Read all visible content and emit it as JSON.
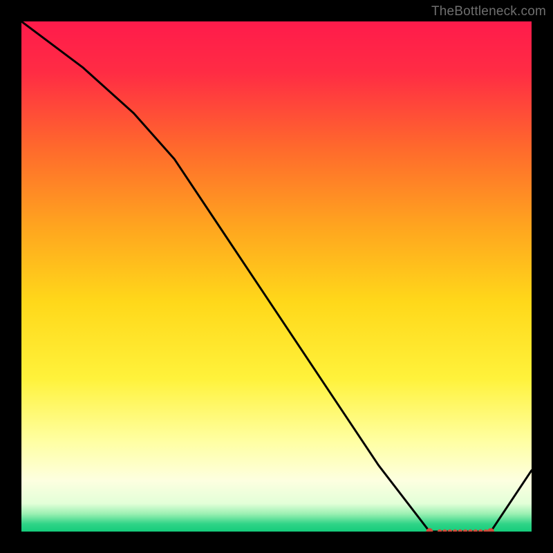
{
  "watermark": "TheBottleneck.com",
  "chart_data": {
    "type": "line",
    "title": "",
    "xlabel": "",
    "ylabel": "",
    "xlim": [
      0,
      100
    ],
    "ylim": [
      0,
      100
    ],
    "grid": false,
    "legend": false,
    "series": [
      {
        "name": "curve",
        "color": "#000000",
        "x": [
          0,
          12,
          22,
          30,
          40,
          50,
          60,
          70,
          80,
          82,
          86,
          90,
          92,
          100
        ],
        "values": [
          100,
          91,
          82,
          73,
          58,
          43,
          28,
          13,
          0,
          0,
          0,
          0,
          0,
          12
        ]
      }
    ],
    "markers": {
      "name": "flat-segment-markers",
      "color": "#d04a3a",
      "x": [
        80,
        82,
        83,
        84,
        85,
        86,
        87,
        88,
        89,
        90,
        91,
        92
      ],
      "values": [
        0,
        0,
        0,
        0,
        0,
        0,
        0,
        0,
        0,
        0,
        0,
        0
      ]
    },
    "gradient_stops": [
      {
        "pos": 0.0,
        "color": "#ff1b4b"
      },
      {
        "pos": 0.1,
        "color": "#ff2c44"
      },
      {
        "pos": 0.25,
        "color": "#ff6a2c"
      },
      {
        "pos": 0.4,
        "color": "#ffa41f"
      },
      {
        "pos": 0.55,
        "color": "#ffd81a"
      },
      {
        "pos": 0.7,
        "color": "#fff23b"
      },
      {
        "pos": 0.82,
        "color": "#ffffa0"
      },
      {
        "pos": 0.9,
        "color": "#fdffe0"
      },
      {
        "pos": 0.945,
        "color": "#e3ffd8"
      },
      {
        "pos": 0.965,
        "color": "#9cf0b3"
      },
      {
        "pos": 0.985,
        "color": "#2fd487"
      },
      {
        "pos": 1.0,
        "color": "#15cc7c"
      }
    ]
  }
}
